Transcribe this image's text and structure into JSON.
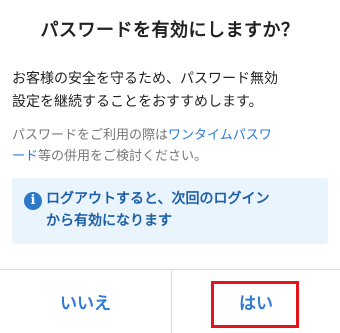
{
  "dialog": {
    "title": "パスワードを有効にしますか？",
    "body_line1": "お客様の安全を守るため、パスワード無効",
    "body_line2": "設定を継続することをおすすめします。",
    "sub_prefix": "パスワードをご利用の際は",
    "sub_link_part1": "ワンタイムパスワ",
    "sub_link_part2": "ード",
    "sub_suffix": "等の併用をご検討ください。",
    "info_line1": "ログアウトすると、次回のログイン",
    "info_line2": "から有効になります",
    "info_icon_glyph": "i",
    "info_icon": "info-icon"
  },
  "buttons": {
    "no_label": "いいえ",
    "yes_label": "はい"
  },
  "colors": {
    "accent": "#2f7ad9",
    "info_bg": "#eaf4fc",
    "info_text": "#1d5fa8",
    "highlight": "#e3151a"
  }
}
